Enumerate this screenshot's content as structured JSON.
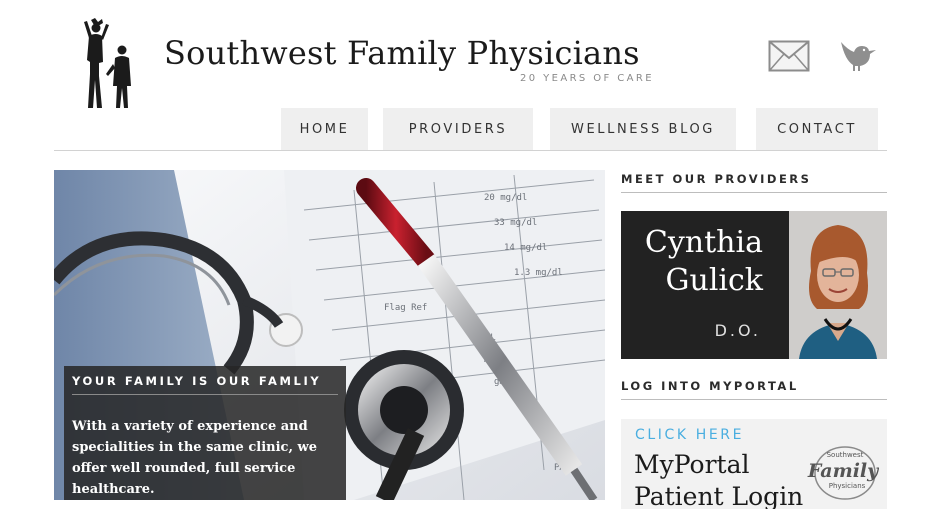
{
  "site": {
    "title": "Southwest Family Physicians",
    "tagline": "20 YEARS OF CARE",
    "icons": [
      "envelope-icon",
      "bird-icon"
    ]
  },
  "nav": {
    "items": [
      {
        "label": "HOME"
      },
      {
        "label": "PROVIDERS"
      },
      {
        "label": "WELLNESS BLOG"
      },
      {
        "label": "CONTACT"
      }
    ]
  },
  "hero": {
    "heading": "YOUR FAMILY IS OUR FAMLIY",
    "text": "With a variety of experience and specialities in the same clinic, we offer well rounded, full service healthcare."
  },
  "sidebar": {
    "providers_heading": "MEET OUR PROVIDERS",
    "provider": {
      "first_name": "Cynthia",
      "last_name": "Gulick",
      "credential": "D.O."
    },
    "portal_heading": "LOG INTO MYPORTAL",
    "portal": {
      "cta": "CLICK HERE",
      "title": "MyPortal Patient Login",
      "logo_text_top": "Southwest",
      "logo_text_main": "Family",
      "logo_text_bottom": "Physicians"
    }
  },
  "colors": {
    "accent": "#4aaee0",
    "nav_bg": "#efefef",
    "dark_panel": "#222222"
  }
}
